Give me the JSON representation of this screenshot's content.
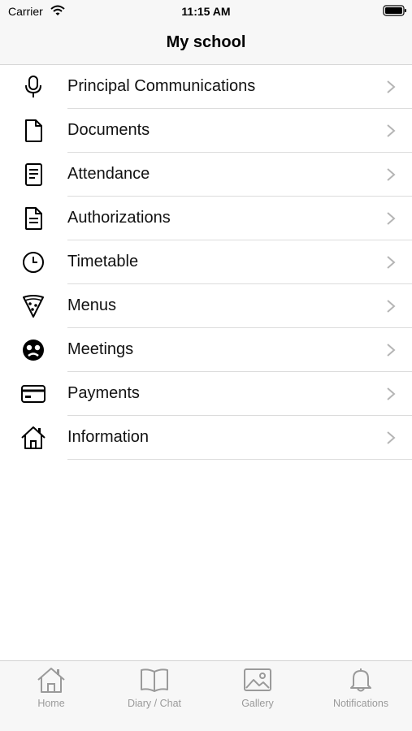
{
  "status_bar": {
    "carrier": "Carrier",
    "time": "11:15 AM"
  },
  "header": {
    "title": "My school"
  },
  "menu": {
    "items": [
      {
        "label": "Principal Communications",
        "icon": "microphone-icon"
      },
      {
        "label": "Documents",
        "icon": "document-icon"
      },
      {
        "label": "Attendance",
        "icon": "attendance-sheet-icon"
      },
      {
        "label": "Authorizations",
        "icon": "authorization-file-icon"
      },
      {
        "label": "Timetable",
        "icon": "clock-icon"
      },
      {
        "label": "Menus",
        "icon": "pizza-slice-icon"
      },
      {
        "label": "Meetings",
        "icon": "meeting-face-icon"
      },
      {
        "label": "Payments",
        "icon": "credit-card-icon"
      },
      {
        "label": "Information",
        "icon": "house-icon"
      }
    ]
  },
  "tab_bar": {
    "tabs": [
      {
        "label": "Home",
        "icon": "home-icon"
      },
      {
        "label": "Diary / Chat",
        "icon": "open-book-icon"
      },
      {
        "label": "Gallery",
        "icon": "image-icon"
      },
      {
        "label": "Notifications",
        "icon": "bell-icon"
      }
    ],
    "inactive_color": "#9a9a9a"
  }
}
